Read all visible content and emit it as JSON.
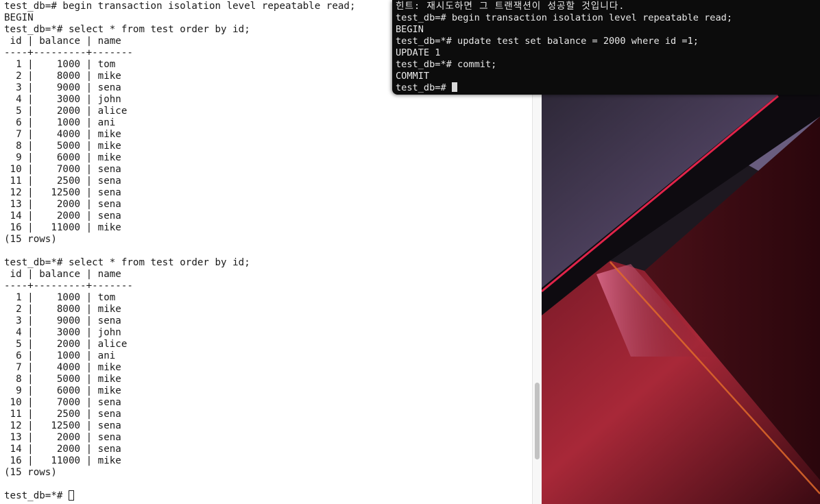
{
  "left_terminal": {
    "lines_before_cursor": [
      "test_db=# begin transaction isolation level repeatable read;",
      "BEGIN",
      "test_db=*# select * from test order by id;",
      " id | balance | name",
      "----+---------+-------",
      "  1 |    1000 | tom",
      "  2 |    8000 | mike",
      "  3 |    9000 | sena",
      "  4 |    3000 | john",
      "  5 |    2000 | alice",
      "  6 |    1000 | ani",
      "  7 |    4000 | mike",
      "  8 |    5000 | mike",
      "  9 |    6000 | mike",
      " 10 |    7000 | sena",
      " 11 |    2500 | sena",
      " 12 |   12500 | sena",
      " 13 |    2000 | sena",
      " 14 |    2000 | sena",
      " 16 |   11000 | mike",
      "(15 rows)",
      "",
      "test_db=*# select * from test order by id;",
      " id | balance | name",
      "----+---------+-------",
      "  1 |    1000 | tom",
      "  2 |    8000 | mike",
      "  3 |    9000 | sena",
      "  4 |    3000 | john",
      "  5 |    2000 | alice",
      "  6 |    1000 | ani",
      "  7 |    4000 | mike",
      "  8 |    5000 | mike",
      "  9 |    6000 | mike",
      " 10 |    7000 | sena",
      " 11 |    2500 | sena",
      " 12 |   12500 | sena",
      " 13 |    2000 | sena",
      " 14 |    2000 | sena",
      " 16 |   11000 | mike",
      "(15 rows)",
      ""
    ],
    "prompt": "test_db=*# ",
    "scrollbar_fraction": 0.85
  },
  "right_terminal": {
    "hint": "힌트: 재시도하면 그 트랜잭션이 성공할 것입니다.",
    "lines": [
      "test_db=# begin transaction isolation level repeatable read;",
      "BEGIN",
      "test_db=*# update test set balance = 2000 where id =1;",
      "UPDATE 1",
      "test_db=*# commit;",
      "COMMIT"
    ],
    "prompt": "test_db=# "
  },
  "colors": {
    "left_terminal_bg": "#ffffff",
    "left_terminal_fg": "#1a1a1a",
    "right_terminal_bg": "#0c0c0c",
    "right_terminal_fg": "#e8e8e8",
    "wallpaper_accent_red": "#e0244a"
  }
}
